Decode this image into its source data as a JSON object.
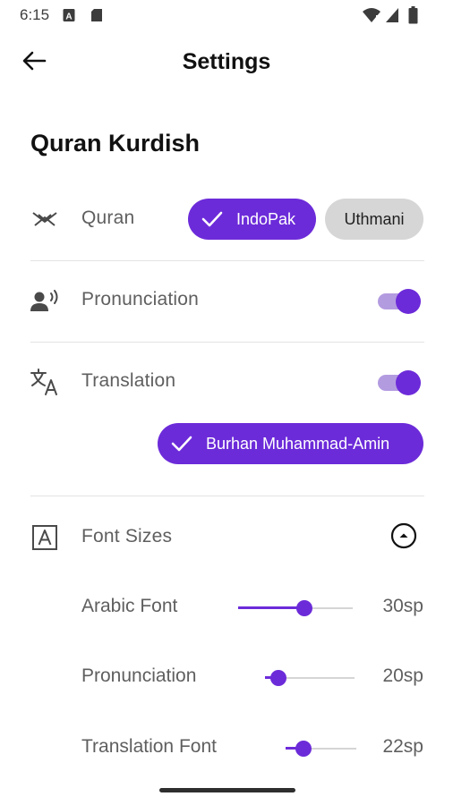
{
  "status_bar": {
    "time": "6:15",
    "icons": [
      "text-notification-icon",
      "sd-card-icon",
      "wifi-icon",
      "signal-icon",
      "battery-icon"
    ]
  },
  "app_bar": {
    "title": "Settings",
    "back_icon": "back-arrow-icon"
  },
  "section": {
    "title": "Quran Kurdish"
  },
  "quran": {
    "label": "Quran",
    "icon": "quran-book-icon",
    "options": [
      {
        "label": "IndoPak",
        "selected": true
      },
      {
        "label": "Uthmani",
        "selected": false
      }
    ]
  },
  "pronunciation": {
    "label": "Pronunciation",
    "icon": "speaker-person-icon",
    "enabled": true
  },
  "translation": {
    "label": "Translation",
    "icon": "translate-icon",
    "enabled": true,
    "translator": {
      "label": "Burhan Muhammad-Amin",
      "selected": true
    }
  },
  "font_sizes": {
    "label": "Font Sizes",
    "icon": "font-box-icon",
    "expanded": true,
    "collapse_icon": "chevron-up-circle-icon",
    "sliders": [
      {
        "label": "Arabic Font",
        "value_text": "30sp",
        "fraction": 0.58
      },
      {
        "label": "Pronunciation",
        "value_text": "20sp",
        "fraction": 0.15
      },
      {
        "label": "Translation Font",
        "value_text": "22sp",
        "fraction": 0.25
      }
    ]
  },
  "colors": {
    "accent": "#6c2bd9",
    "accent_light": "#b39be0",
    "chip_unselected": "#d6d6d6",
    "text_secondary": "#5f5f5f"
  }
}
